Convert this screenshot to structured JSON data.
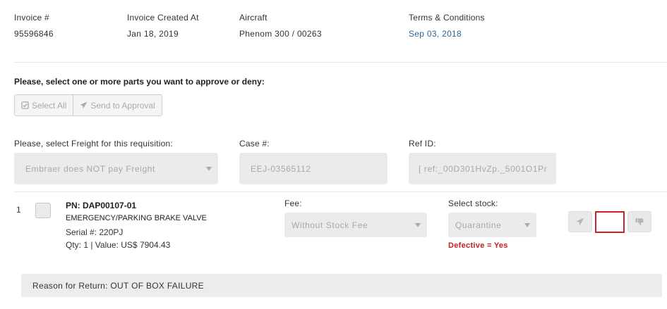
{
  "invoice": {
    "number_label": "Invoice #",
    "number_value": "95596846",
    "created_label": "Invoice Created At",
    "created_value": "Jan 18, 2019",
    "aircraft_label": "Aircraft",
    "aircraft_value": "Phenom 300 / 00263",
    "terms_label": "Terms & Conditions",
    "terms_value": "Sep 03, 2018"
  },
  "selection": {
    "prompt": "Please, select one or more parts you want to approve or deny:",
    "select_all_label": "Select All",
    "select_all_icon": "check-square-icon",
    "send_label": "Send to Approval",
    "send_icon": "paper-plane-icon"
  },
  "requisition": {
    "freight_label": "Please, select Freight for this requisition:",
    "freight_value": "Embraer does NOT pay Freight",
    "case_label": "Case #:",
    "case_value": "EEJ-03565112",
    "ref_label": "Ref ID:",
    "ref_value": "[ ref:_00D301HvZp._5001O1Pr"
  },
  "part": {
    "index": "1",
    "pn": "PN: DAP00107-01",
    "description": "EMERGENCY/PARKING BRAKE VALVE",
    "serial": "Serial #: 220PJ",
    "qty_value": "Qty: 1 | Value: US$ 7904.43",
    "fee_label": "Fee:",
    "fee_value": "Without Stock Fee",
    "stock_label": "Select stock:",
    "stock_value": "Quarantine",
    "defective": "Defective = Yes",
    "reason": "Reason for Return: OUT OF BOX FAILURE",
    "actions": [
      "paper-plane-icon",
      "blank-highlighted-button",
      "thumbs-down-icon"
    ]
  },
  "colors": {
    "link": "#2a6496",
    "defective": "#c41e1e",
    "highlight_border": "#cc2222",
    "field_bg": "#ebebeb"
  }
}
